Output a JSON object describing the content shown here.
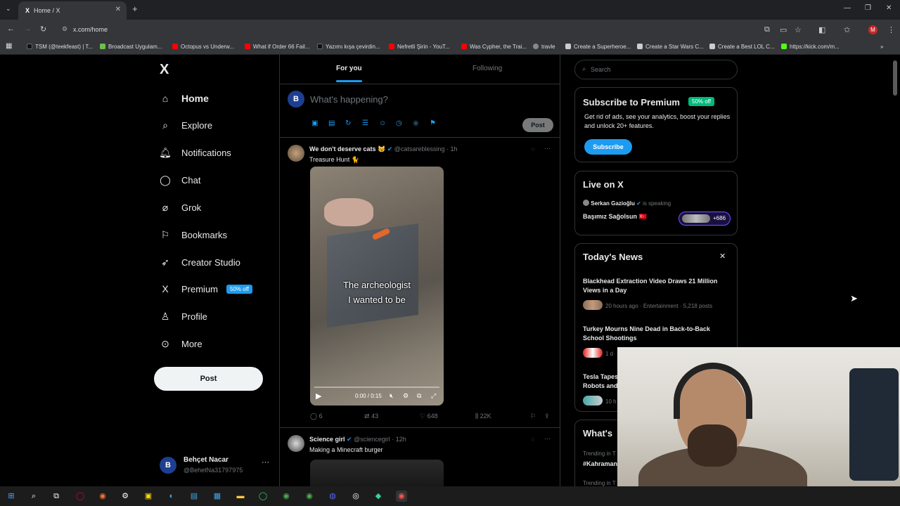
{
  "browser": {
    "tab_title": "Home / X",
    "url": "x.com/home",
    "bookmarks": [
      "TSM (@teekfeast) | T...",
      "Broadcast Uygulam...",
      "Octopus vs Underw...",
      "What if Order 66 Fail...",
      "Yazımı kışa çevirdin...",
      "Nefretli Şirin - YouT...",
      "Was Cypher, the Trai...",
      "travle",
      "Create a Superheroe...",
      "Create a Star Wars C...",
      "Create a Best LOL C...",
      "https://kick.com/m..."
    ],
    "profile_initial": "M"
  },
  "sidebar": {
    "logo": "X",
    "items": [
      {
        "label": "Home"
      },
      {
        "label": "Explore"
      },
      {
        "label": "Notifications"
      },
      {
        "label": "Chat"
      },
      {
        "label": "Grok"
      },
      {
        "label": "Bookmarks"
      },
      {
        "label": "Creator Studio"
      },
      {
        "label": "Premium",
        "badge": "50% off"
      },
      {
        "label": "Profile"
      },
      {
        "label": "More"
      }
    ],
    "post_button": "Post",
    "account": {
      "initial": "B",
      "name": "Behçet Nacar",
      "handle": "@BehetNa31797975",
      "menu": "···"
    }
  },
  "main": {
    "tabs": [
      "For you",
      "Following"
    ],
    "composer": {
      "initial": "B",
      "placeholder": "What's happening?",
      "post_button": "Post"
    },
    "tweets": [
      {
        "name": "We don't deserve cats 😼",
        "handle": "@catsareblessing",
        "time": "· 1h",
        "text": "Treasure Hunt 🐈",
        "video_caption": "The archeologist\nI wanted to be",
        "video_time": "0:00 / 0:15",
        "replies": "6",
        "reposts": "43",
        "likes": "648",
        "views": "22K"
      },
      {
        "name": "Science girl",
        "handle": "@sciencegirl",
        "time": "· 12h",
        "text": "Making a Minecraft burger"
      }
    ]
  },
  "right": {
    "search_placeholder": "Search",
    "premium": {
      "title": "Subscribe to Premium",
      "badge": "50% off",
      "description": "Get rid of ads, see your analytics, boost your replies and unlock 20+ features.",
      "button": "Subscribe"
    },
    "live": {
      "title": "Live on X",
      "host": "Serkan Gazioğlu",
      "status": "is speaking",
      "space_title": "Başımız Sağolsun 🇹🇷",
      "listeners": "+686"
    },
    "news": {
      "title": "Today's News",
      "items": [
        {
          "title": "Blackhead Extraction Video Draws 21 Million Views in a Day",
          "meta": "20 hours ago · Entertainment · 5,218 posts"
        },
        {
          "title": "Turkey Mourns Nine Dead in Back-to-Back School Shootings",
          "meta": "1 d"
        },
        {
          "title": "Tesla Tapes\nRobots and",
          "meta": "10 h"
        }
      ]
    },
    "whats": {
      "title": "What's",
      "trend1_meta": "Trending in T",
      "trend1": "#Kahraman",
      "trend2_meta": "Trending in T"
    }
  },
  "colors": {
    "accent": "#1d9bf0",
    "green": "#00ba7c",
    "background": "#000000"
  }
}
